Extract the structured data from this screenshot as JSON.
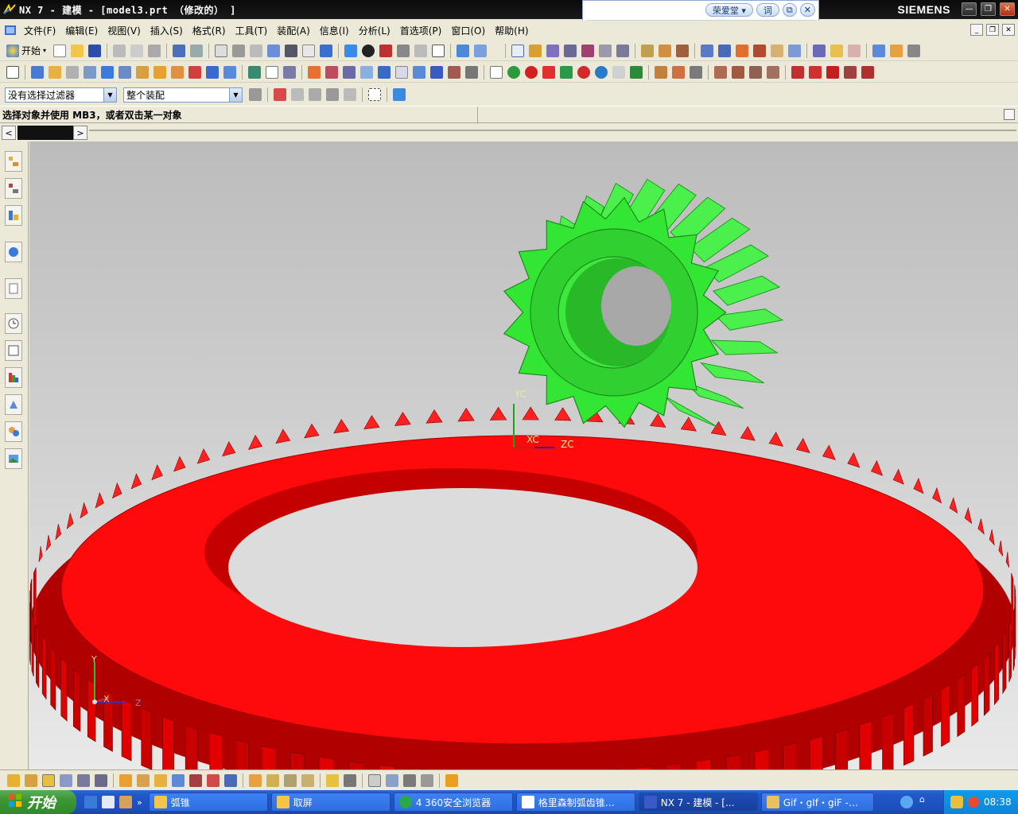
{
  "window": {
    "title": "NX 7 - 建模 - [model3.prt （修改的） ]",
    "brand": "SIEMENS",
    "minimize": "—",
    "restore": "❐",
    "close": "✕"
  },
  "ime": {
    "name": "荣爱堂 ▾",
    "ci": "词",
    "copy": "⧉",
    "close": "✕"
  },
  "menubar": {
    "items": [
      "文件(F)",
      "编辑(E)",
      "视图(V)",
      "插入(S)",
      "格式(R)",
      "工具(T)",
      "装配(A)",
      "信息(I)",
      "分析(L)",
      "首选项(P)",
      "窗口(O)",
      "帮助(H)"
    ]
  },
  "toolbar": {
    "start_label": "开始"
  },
  "selection": {
    "filter_value": "没有选择过滤器",
    "scope_value": "整个装配"
  },
  "cue": {
    "text": "选择对象并使用 MB3，或者双击某一对象"
  },
  "viewport": {
    "axis_labels": {
      "yc": "YC",
      "xc": "XC",
      "zc": "ZC",
      "y": "Y",
      "x": "X",
      "z": "Z"
    },
    "colors": {
      "pinion": "#33e633",
      "ring_gear": "#ff0a0a",
      "background_top": "#bcbcbc",
      "background_bottom": "#e9e9e9"
    }
  },
  "taskbar": {
    "start_label": "开始",
    "tasks": [
      {
        "label": "弧锥",
        "icon": "folder-icon"
      },
      {
        "label": "取屏",
        "icon": "folder-icon"
      },
      {
        "label": "4 360安全浏览器",
        "icon": "browser-icon"
      },
      {
        "label": "格里森制弧齿锥…",
        "icon": "document-icon"
      },
      {
        "label": "NX 7 - 建模 - [...",
        "icon": "nx-icon"
      },
      {
        "label": "Gif・gIf・giF -…",
        "icon": "image-editor-icon"
      }
    ],
    "clock": "08:38"
  }
}
